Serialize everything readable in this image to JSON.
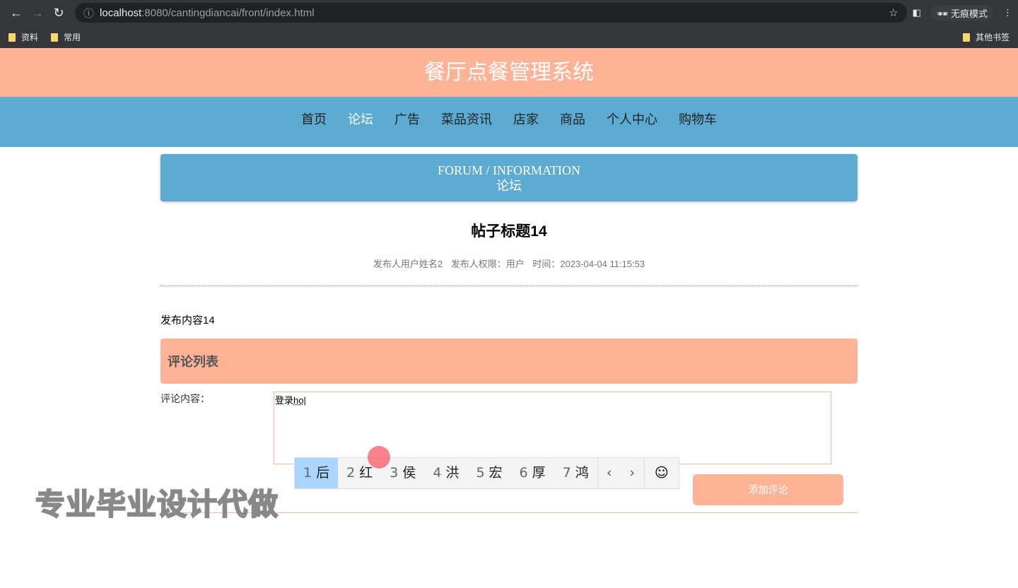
{
  "browser": {
    "url_host": "localhost",
    "url_rest": ":8080/cantingdiancai/front/index.html",
    "incognito": "无痕模式",
    "bookmarks": [
      "资料",
      "常用"
    ],
    "other_bookmarks": "其他书签"
  },
  "site": {
    "title": "餐厅点餐管理系统",
    "nav": [
      "首页",
      "论坛",
      "广告",
      "菜品资讯",
      "店家",
      "商品",
      "个人中心",
      "购物车"
    ]
  },
  "banner": {
    "en": "FORUM / INFORMATION",
    "cn": "论坛"
  },
  "post": {
    "title": "帖子标题14",
    "author": "发布人用户姓名2",
    "role": "发布人权限：用户",
    "time": "时间：2023-04-04 11:15:53",
    "content": "发布内容14"
  },
  "comments": {
    "header": "评论列表",
    "label": "评论内容：",
    "value": "登录",
    "composing": "ho",
    "submit": "添加评论"
  },
  "ime": {
    "candidates": [
      {
        "n": "1",
        "c": "后"
      },
      {
        "n": "2",
        "c": "红"
      },
      {
        "n": "3",
        "c": "侯"
      },
      {
        "n": "4",
        "c": "洪"
      },
      {
        "n": "5",
        "c": "宏"
      },
      {
        "n": "6",
        "c": "厚"
      },
      {
        "n": "7",
        "c": "鸿"
      }
    ],
    "prev": "‹",
    "next": "›",
    "emoji": "☺"
  },
  "watermark": "专业毕业设计代做"
}
